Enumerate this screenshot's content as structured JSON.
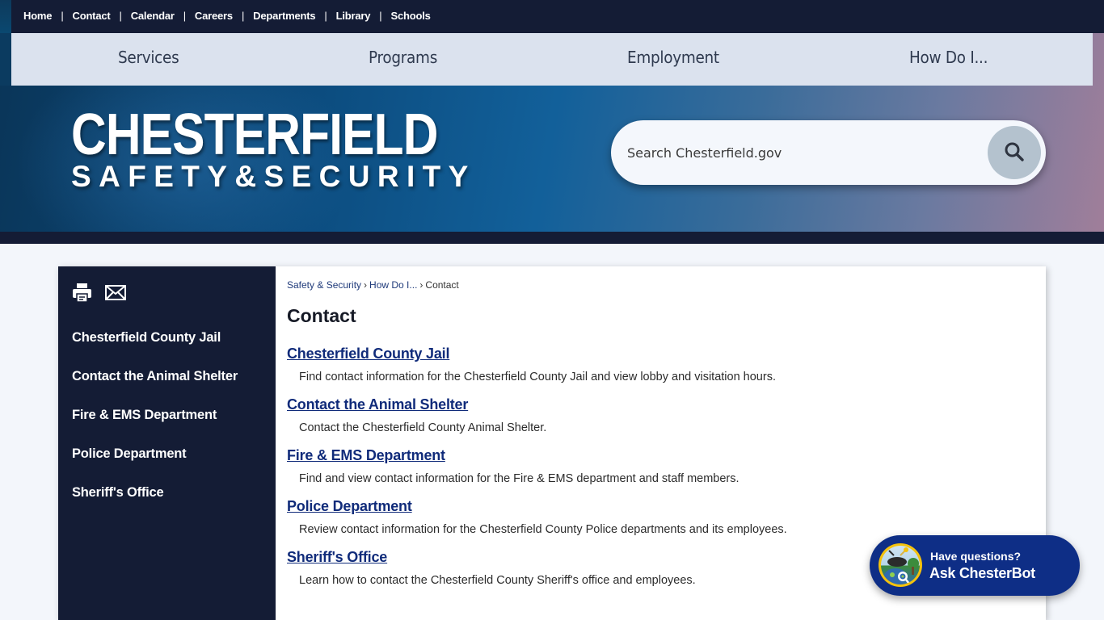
{
  "utility_nav": {
    "items": [
      "Home",
      "Contact",
      "Calendar",
      "Careers",
      "Departments",
      "Library",
      "Schools"
    ],
    "separator": "|"
  },
  "main_nav": {
    "items": [
      "Services",
      "Programs",
      "Employment",
      "How Do I..."
    ]
  },
  "logo": {
    "line1": "CHESTERFIELD",
    "line2": "SAFETY&SECURITY"
  },
  "search": {
    "placeholder": "Search Chesterfield.gov",
    "value": "",
    "button_icon": "search-icon"
  },
  "sidebar": {
    "tools": [
      {
        "icon": "print-icon",
        "label": "Print"
      },
      {
        "icon": "email-icon",
        "label": "Email"
      }
    ],
    "items": [
      "Chesterfield County Jail",
      "Contact the Animal Shelter",
      "Fire & EMS Department",
      "Police Department",
      "Sheriff's Office"
    ]
  },
  "breadcrumb": {
    "items": [
      "Safety & Security",
      "How Do I...",
      "Contact"
    ],
    "separator": "›"
  },
  "page": {
    "title": "Contact",
    "entries": [
      {
        "title": "Chesterfield County Jail",
        "description": "Find contact information for the Chesterfield County Jail and view lobby and visitation hours."
      },
      {
        "title": "Contact the Animal Shelter",
        "description": "Contact the Chesterfield County Animal Shelter."
      },
      {
        "title": "Fire & EMS Department",
        "description": "Find and view contact information for the Fire & EMS department and staff members."
      },
      {
        "title": "Police Department",
        "description": "Review contact information for the Chesterfield County Police departments and its employees."
      },
      {
        "title": "Sheriff's Office",
        "description": "Learn how to contact the Chesterfield County Sheriff's office and employees."
      }
    ]
  },
  "chatbot": {
    "line1": "Have questions?",
    "line2": "Ask ChesterBot"
  },
  "colors": {
    "navy": "#141c35",
    "link": "#102b7a",
    "nav_bg": "#dbe2ee",
    "chatbot_bg": "#0e2e86",
    "chatbot_ring": "#f4c20d"
  }
}
